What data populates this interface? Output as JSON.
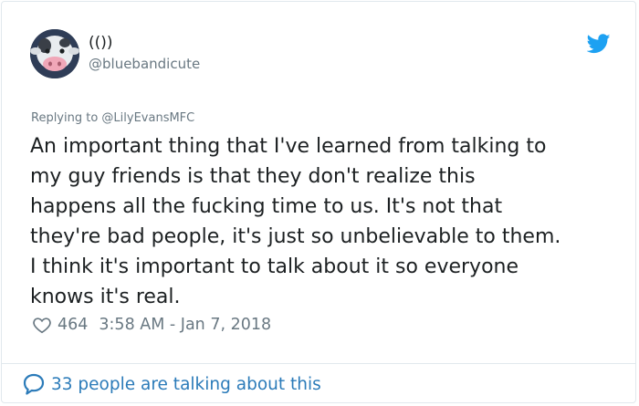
{
  "tweet": {
    "display_name": "(())",
    "handle": "@bluebandicute",
    "replying_to": "Replying to @LilyEvansMFC",
    "body_lines": [
      "An important thing that I've learned from talking to",
      "my guy friends is that they don't realize this",
      "happens all the fucking time to us. It's not that",
      "they're bad people, it's just so unbelievable to them.",
      "I think it's important to talk about it so everyone",
      "knows it's real."
    ],
    "likes": "464",
    "timestamp": "3:58 AM - Jan 7, 2018",
    "discussion": "33 people are talking about this"
  },
  "icons": {
    "brand": "twitter-bird-icon",
    "like": "heart-icon",
    "reply": "speech-bubble-icon"
  },
  "colors": {
    "twitter_blue": "#1da1f2",
    "link_blue": "#2b7bb9",
    "muted_gray": "#697882",
    "text": "#1c2022"
  }
}
